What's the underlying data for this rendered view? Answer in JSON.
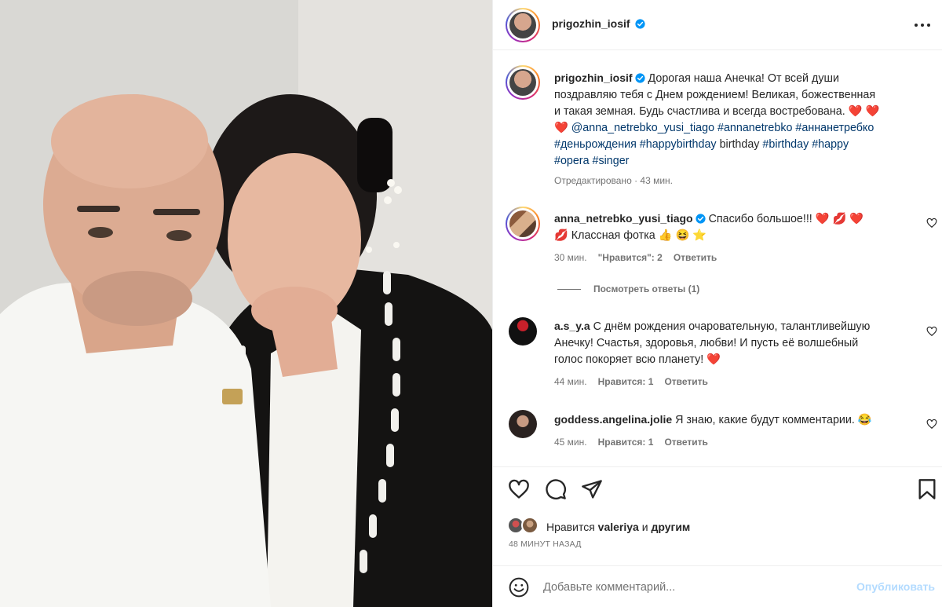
{
  "post": {
    "author": "prigozhin_iosif"
  },
  "caption": {
    "username": "prigozhin_iosif",
    "line1": " Дорогая наша Анечка! От всей души",
    "line2": "поздравляю тебя с Днем рождением! Великая, божественная",
    "line3": "и такая земная. Будь счастлива и всегда востребована.",
    "line4_mention": "@anna_netrebko_yusi_tiago",
    "line4_tag1": "#annanetrebko",
    "line4_tag2": "#аннанетребко",
    "line5_tag1": "#деньрождения",
    "line5_tag2": "#happybirthday",
    "line5_plain": "birthday",
    "line5_tag3": "#birthday",
    "line5_tag4": "#happy",
    "line6_tag1": "#opera",
    "line6_tag2": "#singer",
    "edited": "Отредактировано · 43 мин."
  },
  "comments": [
    {
      "username": "anna_netrebko_yusi_tiago",
      "line1": " Спасибо большое!!!",
      "line2": " Классная фотка",
      "time": "30 мин.",
      "likes": "\"Нравится\": 2",
      "reply": "Ответить"
    },
    {
      "username": "a.s_y.a",
      "line1": " С днём рождения очаровательную, талантливейшую",
      "line2": "Анечку! Счастья, здоровья, любви! И пусть её волшебный",
      "line3": "голос покоряет всю планету!",
      "time": "44 мин.",
      "likes": "Нравится: 1",
      "reply": "Ответить"
    },
    {
      "username": "goddess.angelina.jolie",
      "line1": " Я знаю, какие будут комментарии.",
      "time": "45 мин.",
      "likes": "Нравится: 1",
      "reply": "Ответить"
    }
  ],
  "view_replies": "Посмотреть ответы (1)",
  "likes": {
    "prefix": "Нравится ",
    "user": "valeriya",
    "middle": " и ",
    "others": "другим"
  },
  "time_ago": "48 МИНУТ НАЗАД",
  "add_comment": {
    "placeholder": "Добавьте комментарий...",
    "publish": "Опубликовать"
  },
  "colors": {
    "link": "#00376b",
    "verified": "#0095f6",
    "heart": "#ed4956",
    "publish_disabled": "#b3dbff"
  },
  "icons": [
    "more-icon",
    "verified-icon",
    "heart-icon",
    "comment-icon",
    "share-icon",
    "bookmark-icon",
    "emoji-icon"
  ]
}
